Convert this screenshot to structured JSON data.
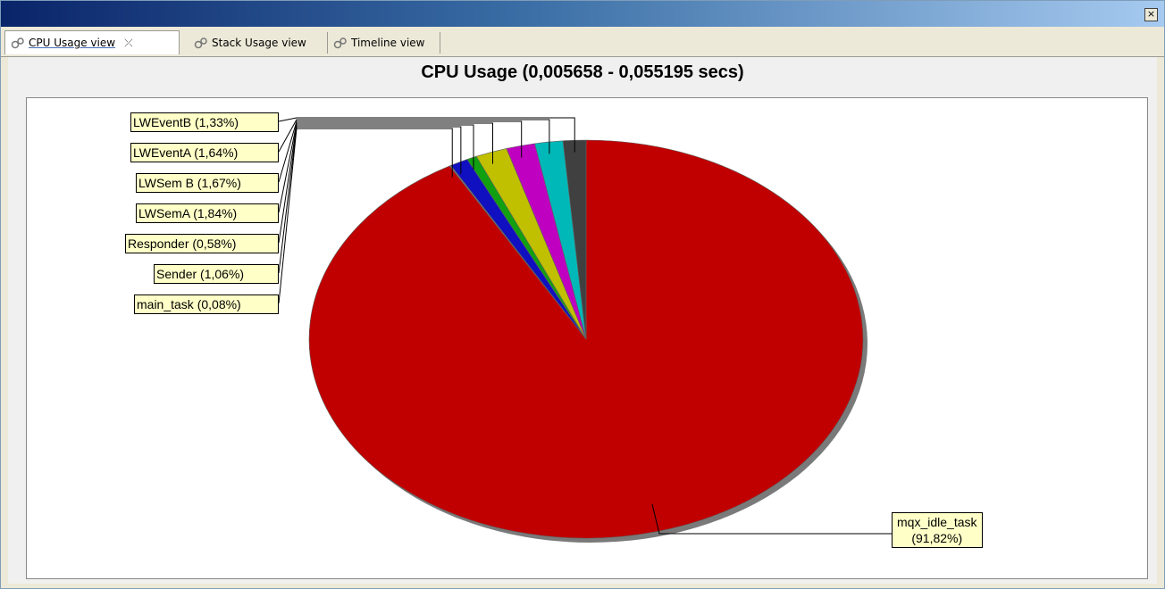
{
  "window": {
    "close_glyph": "×",
    "tabs": [
      {
        "label": "CPU Usage view",
        "icon": "gear-icon"
      },
      {
        "label": "Stack Usage view",
        "icon": "gear-icon"
      },
      {
        "label": "Timeline view",
        "icon": "gear-icon"
      }
    ],
    "tab_close_glyph": "⤫",
    "toolbar": [
      "refresh-icon",
      "open-folder-icon",
      "record-icon",
      "view-menu-icon"
    ]
  },
  "chart_data": {
    "type": "pie",
    "title": "CPU Usage (0,005658 - 0,055195 secs)",
    "slices": [
      {
        "label": "mqx_idle_task",
        "pct_text": "(91,82%)",
        "value": 91.82,
        "color": "#c00000"
      },
      {
        "label": "main_task (0,08%)",
        "value": 0.08,
        "color": "#808080"
      },
      {
        "label": "Sender (1,06%)",
        "value": 1.06,
        "color": "#1010c0"
      },
      {
        "label": "Responder (0,58%)",
        "value": 0.58,
        "color": "#10a010"
      },
      {
        "label": "LWSemA (1,84%)",
        "value": 1.84,
        "color": "#c0c000"
      },
      {
        "label": "LWSem B (1,67%)",
        "value": 1.67,
        "color": "#c000c0"
      },
      {
        "label": "LWEventA (1,64%)",
        "value": 1.64,
        "color": "#00b8b8"
      },
      {
        "label": "LWEventB (1,33%)",
        "value": 1.33,
        "color": "#404040"
      }
    ]
  }
}
